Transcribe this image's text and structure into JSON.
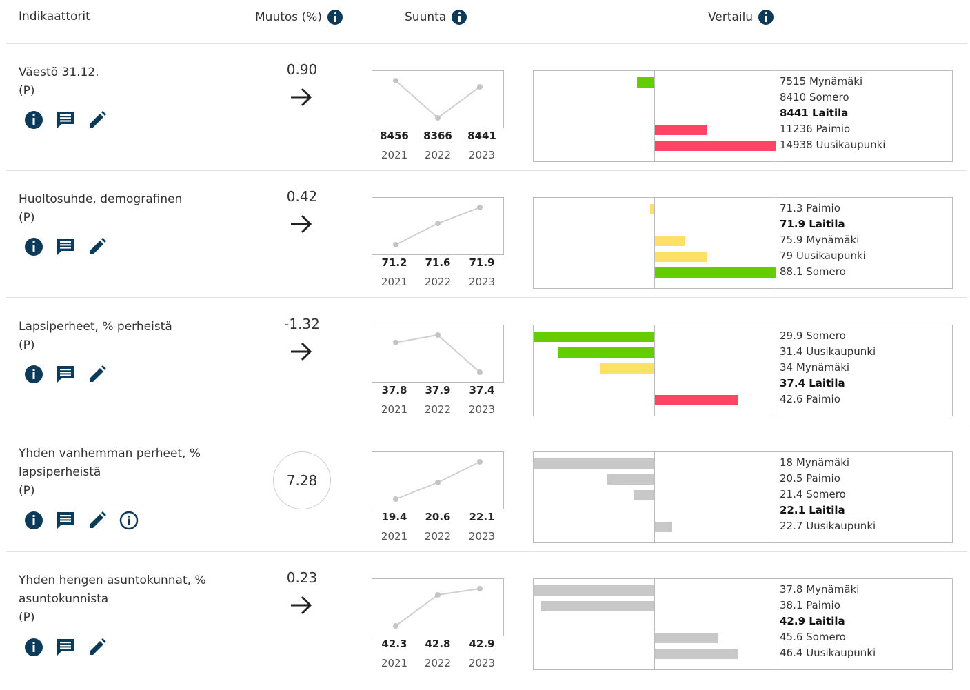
{
  "header": {
    "indicators": "Indikaattorit",
    "change": "Muutos (%)",
    "direction": "Suunta",
    "comparison": "Vertailu"
  },
  "colors": {
    "good": "#66cc00",
    "neutral": "#ffe066",
    "bad": "#ff4466",
    "gray": "#c8c8c8",
    "dark_icon": "#0e3a5a"
  },
  "indicators": [
    {
      "name_lines": [
        "Väestö 31.12.",
        "(P)"
      ],
      "change": "0.90",
      "change_style": "arrow",
      "extra_info_icon": false,
      "sparkline": {
        "values": [
          "8456",
          "8366",
          "8441"
        ],
        "years": [
          "2021",
          "2022",
          "2023"
        ]
      },
      "comparison": [
        {
          "value": "7515",
          "name": "Mynämäki",
          "color": "good",
          "dir": -1,
          "len": 25,
          "bold": false
        },
        {
          "value": "8410",
          "name": "Somero",
          "color": "none",
          "dir": 1,
          "len": 0,
          "bold": false
        },
        {
          "value": "8441",
          "name": "Laitila",
          "color": "none",
          "dir": 1,
          "len": 0,
          "bold": true
        },
        {
          "value": "11236",
          "name": "Paimio",
          "color": "bad",
          "dir": 1,
          "len": 75,
          "bold": false
        },
        {
          "value": "14938",
          "name": "Uusikaupunki",
          "color": "bad",
          "dir": 1,
          "len": 175,
          "bold": false
        }
      ]
    },
    {
      "name_lines": [
        "Huoltosuhde, demografinen",
        "(P)"
      ],
      "change": "0.42",
      "change_style": "arrow",
      "extra_info_icon": false,
      "sparkline": {
        "values": [
          "71.2",
          "71.6",
          "71.9"
        ],
        "years": [
          "2021",
          "2022",
          "2023"
        ]
      },
      "comparison": [
        {
          "value": "71.3",
          "name": "Paimio",
          "color": "neutral",
          "dir": -1,
          "len": 6,
          "bold": false
        },
        {
          "value": "71.9",
          "name": "Laitila",
          "color": "none",
          "dir": 1,
          "len": 0,
          "bold": true
        },
        {
          "value": "75.9",
          "name": "Mynämäki",
          "color": "neutral",
          "dir": 1,
          "len": 43,
          "bold": false
        },
        {
          "value": "79",
          "name": "Uusikaupunki",
          "color": "neutral",
          "dir": 1,
          "len": 76,
          "bold": false
        },
        {
          "value": "88.1",
          "name": "Somero",
          "color": "good",
          "dir": 1,
          "len": 175,
          "bold": false
        }
      ]
    },
    {
      "name_lines": [
        "Lapsiperheet, % perheistä",
        "(P)"
      ],
      "change": "-1.32",
      "change_style": "arrow",
      "extra_info_icon": false,
      "sparkline": {
        "values": [
          "37.8",
          "37.9",
          "37.4"
        ],
        "years": [
          "2021",
          "2022",
          "2023"
        ]
      },
      "comparison": [
        {
          "value": "29.9",
          "name": "Somero",
          "color": "good",
          "dir": -1,
          "len": 175,
          "bold": false
        },
        {
          "value": "31.4",
          "name": "Uusikaupunki",
          "color": "good",
          "dir": -1,
          "len": 140,
          "bold": false
        },
        {
          "value": "34",
          "name": "Mynämäki",
          "color": "neutral",
          "dir": -1,
          "len": 79,
          "bold": false
        },
        {
          "value": "37.4",
          "name": "Laitila",
          "color": "none",
          "dir": 1,
          "len": 0,
          "bold": true
        },
        {
          "value": "42.6",
          "name": "Paimio",
          "color": "bad",
          "dir": 1,
          "len": 121,
          "bold": false
        }
      ]
    },
    {
      "name_lines": [
        "Yhden vanhemman perheet, %",
        "lapsiperheistä",
        "(P)"
      ],
      "change": "7.28",
      "change_style": "circle",
      "extra_info_icon": true,
      "sparkline": {
        "values": [
          "19.4",
          "20.6",
          "22.1"
        ],
        "years": [
          "2021",
          "2022",
          "2023"
        ]
      },
      "comparison": [
        {
          "value": "18",
          "name": "Mynämäki",
          "color": "gray",
          "dir": -1,
          "len": 175,
          "bold": false
        },
        {
          "value": "20.5",
          "name": "Paimio",
          "color": "gray",
          "dir": -1,
          "len": 68,
          "bold": false
        },
        {
          "value": "21.4",
          "name": "Somero",
          "color": "gray",
          "dir": -1,
          "len": 30,
          "bold": false
        },
        {
          "value": "22.1",
          "name": "Laitila",
          "color": "none",
          "dir": 1,
          "len": 0,
          "bold": true
        },
        {
          "value": "22.7",
          "name": "Uusikaupunki",
          "color": "gray",
          "dir": 1,
          "len": 25,
          "bold": false
        }
      ]
    },
    {
      "name_lines": [
        "Yhden hengen asuntokunnat, %",
        "asuntokunnista",
        "(P)"
      ],
      "change": "0.23",
      "change_style": "arrow",
      "extra_info_icon": false,
      "sparkline": {
        "values": [
          "42.3",
          "42.8",
          "42.9"
        ],
        "years": [
          "2021",
          "2022",
          "2023"
        ]
      },
      "comparison": [
        {
          "value": "37.8",
          "name": "Mynämäki",
          "color": "gray",
          "dir": -1,
          "len": 175,
          "bold": false
        },
        {
          "value": "38.1",
          "name": "Paimio",
          "color": "gray",
          "dir": -1,
          "len": 164,
          "bold": false
        },
        {
          "value": "42.9",
          "name": "Laitila",
          "color": "none",
          "dir": 1,
          "len": 0,
          "bold": true
        },
        {
          "value": "45.6",
          "name": "Somero",
          "color": "gray",
          "dir": 1,
          "len": 92,
          "bold": false
        },
        {
          "value": "46.4",
          "name": "Uusikaupunki",
          "color": "gray",
          "dir": 1,
          "len": 120,
          "bold": false
        }
      ]
    }
  ]
}
